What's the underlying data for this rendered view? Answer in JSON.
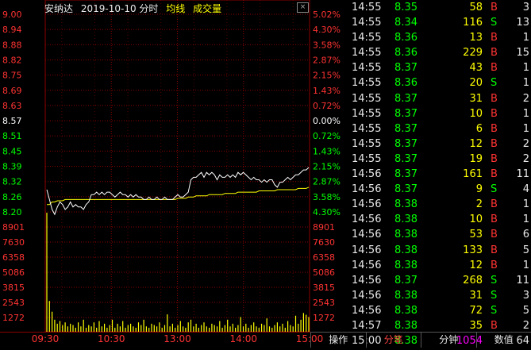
{
  "header": {
    "stock_name": "安纳达",
    "date_label": "2019-10-10 分时",
    "avg_label": "均线",
    "vol_label": "成交量",
    "close_symbol": "×"
  },
  "chart_data": {
    "type": "line",
    "price_axis": [
      "9.00",
      "8.94",
      "8.88",
      "8.82",
      "8.75",
      "8.69",
      "8.63",
      "8.57",
      "8.51",
      "8.45",
      "8.39",
      "8.32",
      "8.26",
      "8.20"
    ],
    "pct_axis": [
      "5.02%",
      "4.30%",
      "3.58%",
      "2.87%",
      "2.15%",
      "1.43%",
      "0.72%",
      "0.00%",
      "0.72%",
      "1.43%",
      "2.15%",
      "2.87%",
      "3.58%",
      "4.30%"
    ],
    "prev_close": 8.57,
    "price_range": [
      8.2,
      9.0
    ],
    "volume_axis": [
      "8901",
      "7630",
      "6358",
      "5086",
      "3815",
      "2543",
      "1272"
    ],
    "volume_max": 8901,
    "time_axis": [
      "09:30",
      "10:30",
      "13:00",
      "14:00",
      "15:00"
    ],
    "series": [
      {
        "values": [
          8.29,
          8.25,
          8.21,
          8.19,
          8.22,
          8.24,
          8.23,
          8.21,
          8.22,
          8.24,
          8.22,
          8.23,
          8.22,
          8.22,
          8.21,
          8.23,
          8.24,
          8.27,
          8.27,
          8.28,
          8.27,
          8.28,
          8.27,
          8.28,
          8.28,
          8.27,
          8.26,
          8.27,
          8.28,
          8.27,
          8.27,
          8.26,
          8.27,
          8.26,
          8.27,
          8.26,
          8.26,
          8.25,
          8.25,
          8.26,
          8.25,
          8.25,
          8.26,
          8.25,
          8.25,
          8.26,
          8.25,
          8.25,
          8.25,
          8.26,
          8.27,
          8.26,
          8.26,
          8.27,
          8.28,
          8.33,
          8.34,
          8.34,
          8.35,
          8.36,
          8.34,
          8.36,
          8.35,
          8.36,
          8.35,
          8.33,
          8.35,
          8.34,
          8.34,
          8.35,
          8.34,
          8.35,
          8.34,
          8.36,
          8.35,
          8.36,
          8.35,
          8.34,
          8.33,
          8.34,
          8.33,
          8.33,
          8.32,
          8.33,
          8.32,
          8.33,
          8.33,
          8.31,
          8.3,
          8.32,
          8.32,
          8.33,
          8.34,
          8.33,
          8.34,
          8.35,
          8.35,
          8.36,
          8.37,
          8.37,
          8.38
        ]
      },
      {
        "values": [
          8.23,
          8.23,
          8.24,
          8.24,
          8.245,
          8.245,
          8.245,
          8.25,
          8.25,
          8.25,
          8.25,
          8.25,
          8.25,
          8.25,
          8.25,
          8.25,
          8.25,
          8.25,
          8.25,
          8.25,
          8.25,
          8.25,
          8.25,
          8.25,
          8.25,
          8.25,
          8.25,
          8.25,
          8.25,
          8.25,
          8.25,
          8.25,
          8.25,
          8.25,
          8.25,
          8.25,
          8.25,
          8.25,
          8.25,
          8.25,
          8.25,
          8.25,
          8.25,
          8.25,
          8.25,
          8.25,
          8.25,
          8.25,
          8.25,
          8.25,
          8.255,
          8.255,
          8.255,
          8.255,
          8.26,
          8.26,
          8.26,
          8.265,
          8.265,
          8.265,
          8.265,
          8.265,
          8.27,
          8.27,
          8.27,
          8.27,
          8.27,
          8.27,
          8.275,
          8.275,
          8.275,
          8.275,
          8.275,
          8.28,
          8.28,
          8.28,
          8.28,
          8.28,
          8.28,
          8.28,
          8.28,
          8.285,
          8.285,
          8.285,
          8.285,
          8.285,
          8.285,
          8.285,
          8.29,
          8.29,
          8.29,
          8.29,
          8.29,
          8.29,
          8.29,
          8.29,
          8.295,
          8.295,
          8.295,
          8.295,
          8.3
        ]
      }
    ],
    "volumes": [
      8901,
      2300,
      1500,
      900,
      600,
      800,
      500,
      700,
      400,
      600,
      500,
      300,
      700,
      400,
      900,
      300,
      500,
      400,
      700,
      300,
      800,
      400,
      600,
      300,
      500,
      900,
      300,
      600,
      400,
      800,
      300,
      500,
      600,
      400,
      300,
      700,
      500,
      900,
      400,
      300,
      600,
      500,
      400,
      700,
      300,
      500,
      1300,
      400,
      600,
      300,
      500,
      800,
      400,
      300,
      700,
      900,
      400,
      600,
      300,
      500,
      700,
      400,
      300,
      600,
      500,
      400,
      800,
      300,
      500,
      900,
      400,
      600,
      300,
      500,
      1100,
      400,
      600,
      300,
      500,
      700,
      400,
      300,
      600,
      500,
      1000,
      400,
      300,
      500,
      700,
      400,
      600,
      300,
      800,
      500,
      400,
      1200,
      600,
      900,
      1400,
      1272,
      1100
    ],
    "price_colors": {
      "up": "#ff3333",
      "down": "#00ff00",
      "flat": "#ffffff",
      "price_line": "#ffffff",
      "avg_line": "#ffff00",
      "volume_bar": "#ffff00",
      "grid": "#8b0000"
    }
  },
  "ticks": [
    {
      "time": "14:55",
      "price": "8.35",
      "vol": "58",
      "side": "B",
      "count": "3"
    },
    {
      "time": "14:55",
      "price": "8.34",
      "vol": "116",
      "side": "S",
      "count": "13"
    },
    {
      "time": "14:55",
      "price": "8.36",
      "vol": "13",
      "side": "B",
      "count": "1"
    },
    {
      "time": "14:55",
      "price": "8.36",
      "vol": "229",
      "side": "B",
      "count": "15"
    },
    {
      "time": "14:55",
      "price": "8.37",
      "vol": "43",
      "side": "B",
      "count": "1"
    },
    {
      "time": "14:55",
      "price": "8.36",
      "vol": "20",
      "side": "S",
      "count": "1"
    },
    {
      "time": "14:55",
      "price": "8.37",
      "vol": "31",
      "side": "B",
      "count": "2"
    },
    {
      "time": "14:55",
      "price": "8.37",
      "vol": "10",
      "side": "B",
      "count": "1"
    },
    {
      "time": "14:55",
      "price": "8.37",
      "vol": "6",
      "side": "B",
      "count": "1"
    },
    {
      "time": "14:55",
      "price": "8.37",
      "vol": "12",
      "side": "B",
      "count": "2"
    },
    {
      "time": "14:55",
      "price": "8.37",
      "vol": "19",
      "side": "B",
      "count": "2"
    },
    {
      "time": "14:56",
      "price": "8.37",
      "vol": "161",
      "side": "B",
      "count": "11"
    },
    {
      "time": "14:56",
      "price": "8.37",
      "vol": "9",
      "side": "S",
      "count": "4"
    },
    {
      "time": "14:56",
      "price": "8.38",
      "vol": "2",
      "side": "B",
      "count": "1"
    },
    {
      "time": "14:56",
      "price": "8.38",
      "vol": "10",
      "side": "B",
      "count": "1"
    },
    {
      "time": "14:56",
      "price": "8.38",
      "vol": "53",
      "side": "B",
      "count": "6"
    },
    {
      "time": "14:56",
      "price": "8.38",
      "vol": "133",
      "side": "B",
      "count": "5"
    },
    {
      "time": "14:56",
      "price": "8.38",
      "vol": "12",
      "side": "B",
      "count": "1"
    },
    {
      "time": "14:56",
      "price": "8.37",
      "vol": "268",
      "side": "S",
      "count": "11"
    },
    {
      "time": "14:56",
      "price": "8.38",
      "vol": "31",
      "side": "S",
      "count": "3"
    },
    {
      "time": "14:56",
      "price": "8.38",
      "vol": "72",
      "side": "S",
      "count": "5"
    },
    {
      "time": "14:57",
      "price": "8.38",
      "vol": "35",
      "side": "B",
      "count": "2"
    },
    {
      "time": "15:00",
      "price": "8.38",
      "vol": "1054",
      "side": "",
      "count": "64"
    }
  ],
  "tabs": {
    "operate": "操作",
    "ticks": "分笔",
    "minute": "分钟",
    "data": "数值"
  }
}
